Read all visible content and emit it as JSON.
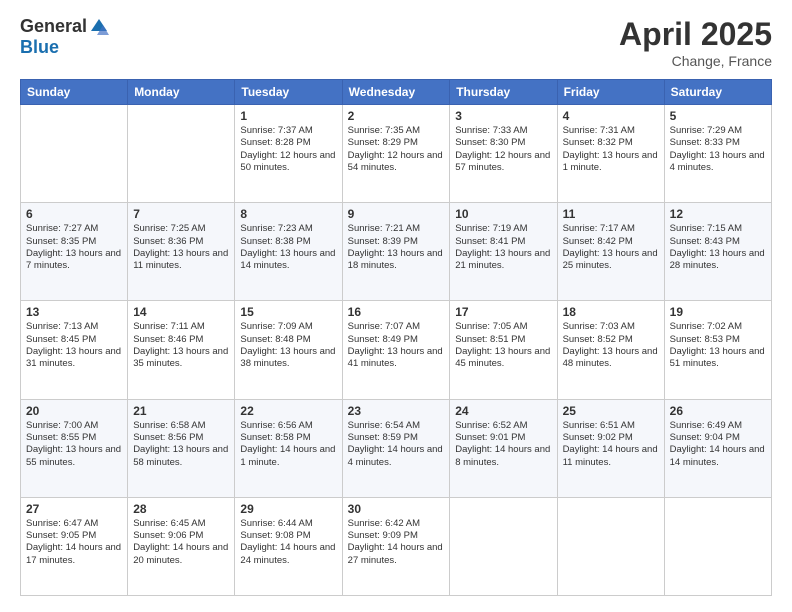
{
  "logo": {
    "general": "General",
    "blue": "Blue"
  },
  "title": "April 2025",
  "subtitle": "Change, France",
  "header_days": [
    "Sunday",
    "Monday",
    "Tuesday",
    "Wednesday",
    "Thursday",
    "Friday",
    "Saturday"
  ],
  "weeks": [
    [
      {
        "day": "",
        "info": ""
      },
      {
        "day": "",
        "info": ""
      },
      {
        "day": "1",
        "info": "Sunrise: 7:37 AM\nSunset: 8:28 PM\nDaylight: 12 hours and 50 minutes."
      },
      {
        "day": "2",
        "info": "Sunrise: 7:35 AM\nSunset: 8:29 PM\nDaylight: 12 hours and 54 minutes."
      },
      {
        "day": "3",
        "info": "Sunrise: 7:33 AM\nSunset: 8:30 PM\nDaylight: 12 hours and 57 minutes."
      },
      {
        "day": "4",
        "info": "Sunrise: 7:31 AM\nSunset: 8:32 PM\nDaylight: 13 hours and 1 minute."
      },
      {
        "day": "5",
        "info": "Sunrise: 7:29 AM\nSunset: 8:33 PM\nDaylight: 13 hours and 4 minutes."
      }
    ],
    [
      {
        "day": "6",
        "info": "Sunrise: 7:27 AM\nSunset: 8:35 PM\nDaylight: 13 hours and 7 minutes."
      },
      {
        "day": "7",
        "info": "Sunrise: 7:25 AM\nSunset: 8:36 PM\nDaylight: 13 hours and 11 minutes."
      },
      {
        "day": "8",
        "info": "Sunrise: 7:23 AM\nSunset: 8:38 PM\nDaylight: 13 hours and 14 minutes."
      },
      {
        "day": "9",
        "info": "Sunrise: 7:21 AM\nSunset: 8:39 PM\nDaylight: 13 hours and 18 minutes."
      },
      {
        "day": "10",
        "info": "Sunrise: 7:19 AM\nSunset: 8:41 PM\nDaylight: 13 hours and 21 minutes."
      },
      {
        "day": "11",
        "info": "Sunrise: 7:17 AM\nSunset: 8:42 PM\nDaylight: 13 hours and 25 minutes."
      },
      {
        "day": "12",
        "info": "Sunrise: 7:15 AM\nSunset: 8:43 PM\nDaylight: 13 hours and 28 minutes."
      }
    ],
    [
      {
        "day": "13",
        "info": "Sunrise: 7:13 AM\nSunset: 8:45 PM\nDaylight: 13 hours and 31 minutes."
      },
      {
        "day": "14",
        "info": "Sunrise: 7:11 AM\nSunset: 8:46 PM\nDaylight: 13 hours and 35 minutes."
      },
      {
        "day": "15",
        "info": "Sunrise: 7:09 AM\nSunset: 8:48 PM\nDaylight: 13 hours and 38 minutes."
      },
      {
        "day": "16",
        "info": "Sunrise: 7:07 AM\nSunset: 8:49 PM\nDaylight: 13 hours and 41 minutes."
      },
      {
        "day": "17",
        "info": "Sunrise: 7:05 AM\nSunset: 8:51 PM\nDaylight: 13 hours and 45 minutes."
      },
      {
        "day": "18",
        "info": "Sunrise: 7:03 AM\nSunset: 8:52 PM\nDaylight: 13 hours and 48 minutes."
      },
      {
        "day": "19",
        "info": "Sunrise: 7:02 AM\nSunset: 8:53 PM\nDaylight: 13 hours and 51 minutes."
      }
    ],
    [
      {
        "day": "20",
        "info": "Sunrise: 7:00 AM\nSunset: 8:55 PM\nDaylight: 13 hours and 55 minutes."
      },
      {
        "day": "21",
        "info": "Sunrise: 6:58 AM\nSunset: 8:56 PM\nDaylight: 13 hours and 58 minutes."
      },
      {
        "day": "22",
        "info": "Sunrise: 6:56 AM\nSunset: 8:58 PM\nDaylight: 14 hours and 1 minute."
      },
      {
        "day": "23",
        "info": "Sunrise: 6:54 AM\nSunset: 8:59 PM\nDaylight: 14 hours and 4 minutes."
      },
      {
        "day": "24",
        "info": "Sunrise: 6:52 AM\nSunset: 9:01 PM\nDaylight: 14 hours and 8 minutes."
      },
      {
        "day": "25",
        "info": "Sunrise: 6:51 AM\nSunset: 9:02 PM\nDaylight: 14 hours and 11 minutes."
      },
      {
        "day": "26",
        "info": "Sunrise: 6:49 AM\nSunset: 9:04 PM\nDaylight: 14 hours and 14 minutes."
      }
    ],
    [
      {
        "day": "27",
        "info": "Sunrise: 6:47 AM\nSunset: 9:05 PM\nDaylight: 14 hours and 17 minutes."
      },
      {
        "day": "28",
        "info": "Sunrise: 6:45 AM\nSunset: 9:06 PM\nDaylight: 14 hours and 20 minutes."
      },
      {
        "day": "29",
        "info": "Sunrise: 6:44 AM\nSunset: 9:08 PM\nDaylight: 14 hours and 24 minutes."
      },
      {
        "day": "30",
        "info": "Sunrise: 6:42 AM\nSunset: 9:09 PM\nDaylight: 14 hours and 27 minutes."
      },
      {
        "day": "",
        "info": ""
      },
      {
        "day": "",
        "info": ""
      },
      {
        "day": "",
        "info": ""
      }
    ]
  ]
}
